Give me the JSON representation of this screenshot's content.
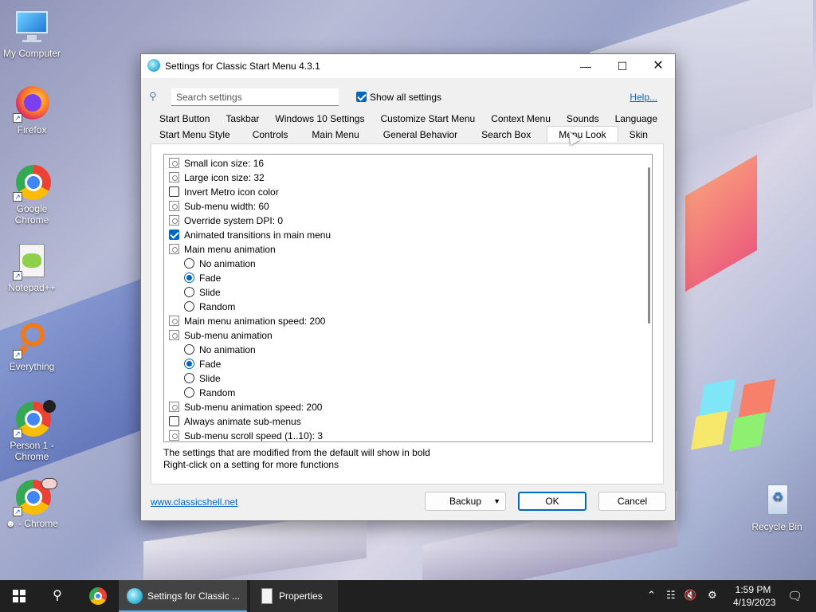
{
  "desktop": {
    "icons": [
      {
        "label": "My Computer"
      },
      {
        "label": "Firefox"
      },
      {
        "label": "Google Chrome"
      },
      {
        "label": "Notepad++"
      },
      {
        "label": "Everything"
      },
      {
        "label": "Person 1 - Chrome"
      },
      {
        "label": "☻ - Chrome"
      },
      {
        "label": "Recycle Bin"
      }
    ]
  },
  "dialog": {
    "title": "Settings for Classic Start Menu 4.3.1",
    "search_placeholder": "Search settings",
    "show_all_label": "Show all settings",
    "show_all_checked": true,
    "help_label": "Help...",
    "tabs_row1": [
      "Start Button",
      "Taskbar",
      "Windows 10 Settings",
      "Customize Start Menu",
      "Context Menu",
      "Sounds",
      "Language"
    ],
    "tabs_row2": [
      "Start Menu Style",
      "Controls",
      "Main Menu",
      "General Behavior",
      "Search Box",
      "Menu Look",
      "Skin"
    ],
    "selected_tab": "Menu Look",
    "settings": [
      {
        "kind": "doc",
        "label": "Small icon size: 16"
      },
      {
        "kind": "doc",
        "label": "Large icon size: 32"
      },
      {
        "kind": "checkbox",
        "checked": false,
        "label": "Invert Metro icon color"
      },
      {
        "kind": "doc",
        "label": "Sub-menu width: 60"
      },
      {
        "kind": "doc",
        "label": "Override system DPI: 0"
      },
      {
        "kind": "checkbox",
        "checked": true,
        "label": "Animated transitions in main menu"
      },
      {
        "kind": "doc",
        "label": "Main menu animation"
      },
      {
        "kind": "radio",
        "checked": false,
        "label": "No animation"
      },
      {
        "kind": "radio",
        "checked": true,
        "label": "Fade"
      },
      {
        "kind": "radio",
        "checked": false,
        "label": "Slide"
      },
      {
        "kind": "radio",
        "checked": false,
        "label": "Random"
      },
      {
        "kind": "doc",
        "label": "Main menu animation speed: 200"
      },
      {
        "kind": "doc",
        "label": "Sub-menu animation"
      },
      {
        "kind": "radio",
        "checked": false,
        "label": "No animation"
      },
      {
        "kind": "radio",
        "checked": true,
        "label": "Fade"
      },
      {
        "kind": "radio",
        "checked": false,
        "label": "Slide"
      },
      {
        "kind": "radio",
        "checked": false,
        "label": "Random"
      },
      {
        "kind": "doc",
        "label": "Sub-menu animation speed: 200"
      },
      {
        "kind": "checkbox",
        "checked": false,
        "label": "Always animate sub-menus"
      },
      {
        "kind": "doc",
        "label": "Sub-menu scroll speed (1..10): 3"
      }
    ],
    "hint1": "The settings that are modified from the default will show in bold",
    "hint2": "Right-click on a setting for more functions",
    "site_link": "www.classicshell.net",
    "backup_label": "Backup",
    "ok_label": "OK",
    "cancel_label": "Cancel"
  },
  "taskbar": {
    "active_window_label": "Settings for Classic ...",
    "properties_label": "Properties",
    "time": "1:59 PM",
    "date": "4/19/2023"
  },
  "colors": {
    "accent": "#0067c0",
    "link": "#0066cc",
    "taskbar": "#202020"
  }
}
